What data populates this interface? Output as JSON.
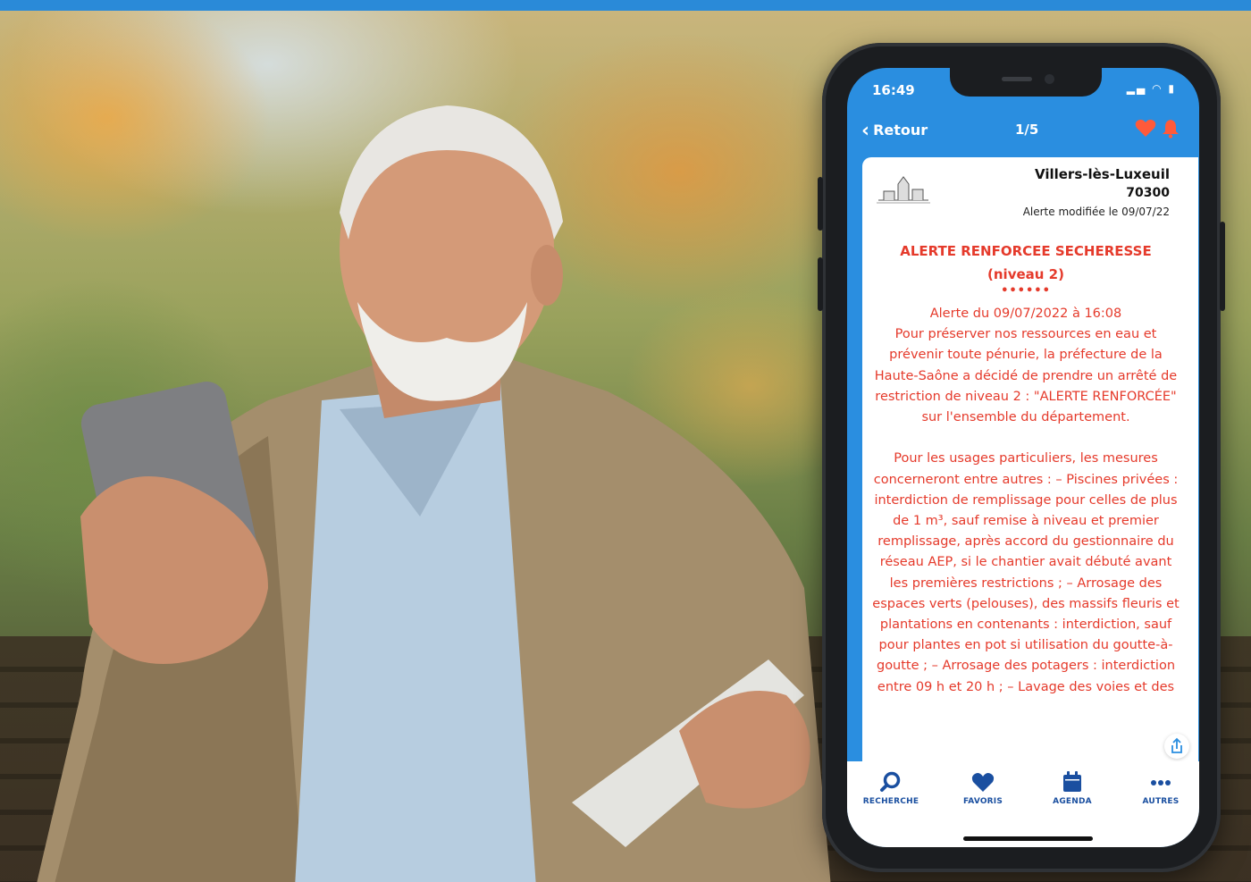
{
  "status_bar": {
    "time": "16:49"
  },
  "nav": {
    "back_label": "Retour",
    "page_indicator": "1/5"
  },
  "card": {
    "commune": "Villers-lès-Luxeuil",
    "postcode": "70300",
    "modified": "Alerte modifiée le 09/07/22",
    "alert_title": "ALERTE RENFORCEE SECHERESSE (niveau 2)",
    "separator": "••••••",
    "alert_body": "Alerte du 09/07/2022 à 16:08\nPour préserver nos ressources en eau et prévenir toute pénurie, la préfecture de la Haute-Saône a décidé de prendre un arrêté de restriction de niveau 2 : \"ALERTE RENFORCÉE\" sur l'ensemble du département.\n\nPour les usages particuliers, les mesures concerneront entre autres : – Piscines privées : interdiction de remplissage pour celles de plus de 1 m³, sauf remise à niveau et premier remplissage, après accord du gestionnaire du réseau AEP, si le chantier avait débuté avant les premières restrictions ; – Arrosage des espaces verts (pelouses), des massifs fleuris et plantations en contenants : interdiction, sauf pour plantes en pot si utilisation du goutte-à-goutte ; – Arrosage des potagers : interdiction entre 09 h et 20 h ; – Lavage des voies et des"
  },
  "tabbar": {
    "search": "RECHERCHE",
    "favorites": "FAVORIS",
    "agenda": "AGENDA",
    "others": "AUTRES"
  },
  "colors": {
    "brand_blue": "#2a8ee0",
    "alert_red": "#e53a2b",
    "tab_blue": "#1a4fa0",
    "heart_orange": "#ff5a3a"
  },
  "icons": [
    "chevron-left-icon",
    "heart-icon",
    "bell-icon",
    "share-icon",
    "search-icon",
    "calendar-icon",
    "more-dots-icon"
  ]
}
